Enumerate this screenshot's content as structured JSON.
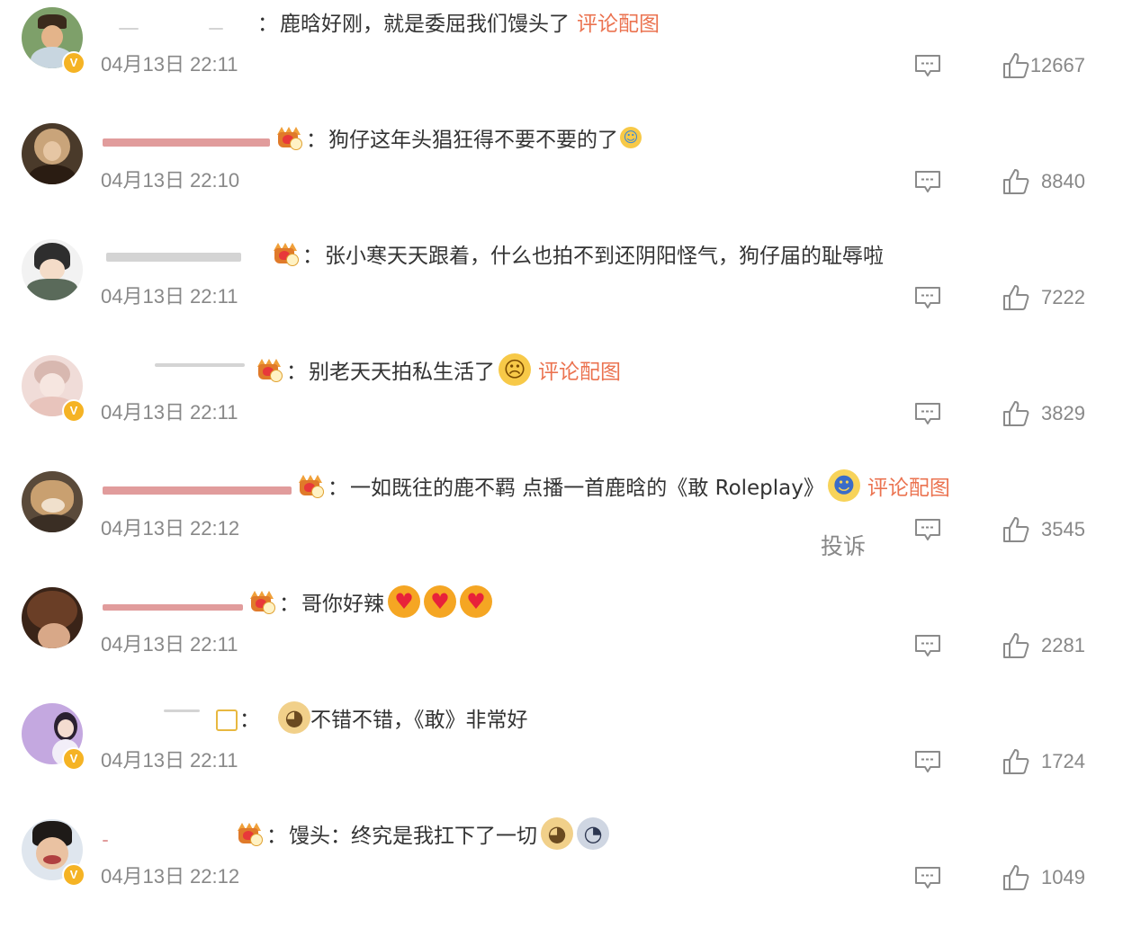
{
  "comments": [
    {
      "time": "04月13日 22:11",
      "text": "鹿晗好刚，就是委屈我们馒头了",
      "pic_link": "评论配图",
      "likes": "12667"
    },
    {
      "time": "04月13日 22:10",
      "text": "狗仔这年头猖狂得不要不要的了",
      "likes": "8840"
    },
    {
      "time": "04月13日 22:11",
      "text": "张小寒天天跟着，什么也拍不到还阴阳怪气，狗仔届的耻辱啦",
      "likes": "7222"
    },
    {
      "time": "04月13日 22:11",
      "text": "别老天天拍私生活了",
      "pic_link": "评论配图",
      "likes": "3829"
    },
    {
      "time": "04月13日 22:12",
      "text": "一如既往的鹿不羁 点播一首鹿晗的《敢 Roleplay》",
      "pic_link": "评论配图",
      "report": "投诉",
      "likes": "3545"
    },
    {
      "time": "04月13日 22:11",
      "text": "哥你好辣",
      "likes": "2281"
    },
    {
      "time": "04月13日 22:11",
      "text": "不错不错，《敢》非常好",
      "likes": "1724"
    },
    {
      "time": "04月13日 22:12",
      "text": "馒头：终究是我扛下了一切",
      "likes": "1049"
    }
  ],
  "colon": "：",
  "verified_badge": "V",
  "icons": {
    "reply": "comment-bubble-icon",
    "like": "thumbs-up-icon",
    "crown": "fan-crown-badge-icon"
  },
  "colors": {
    "link": "#eb7350",
    "meta": "#888888",
    "text": "#333333",
    "verified": "#f5b324"
  }
}
